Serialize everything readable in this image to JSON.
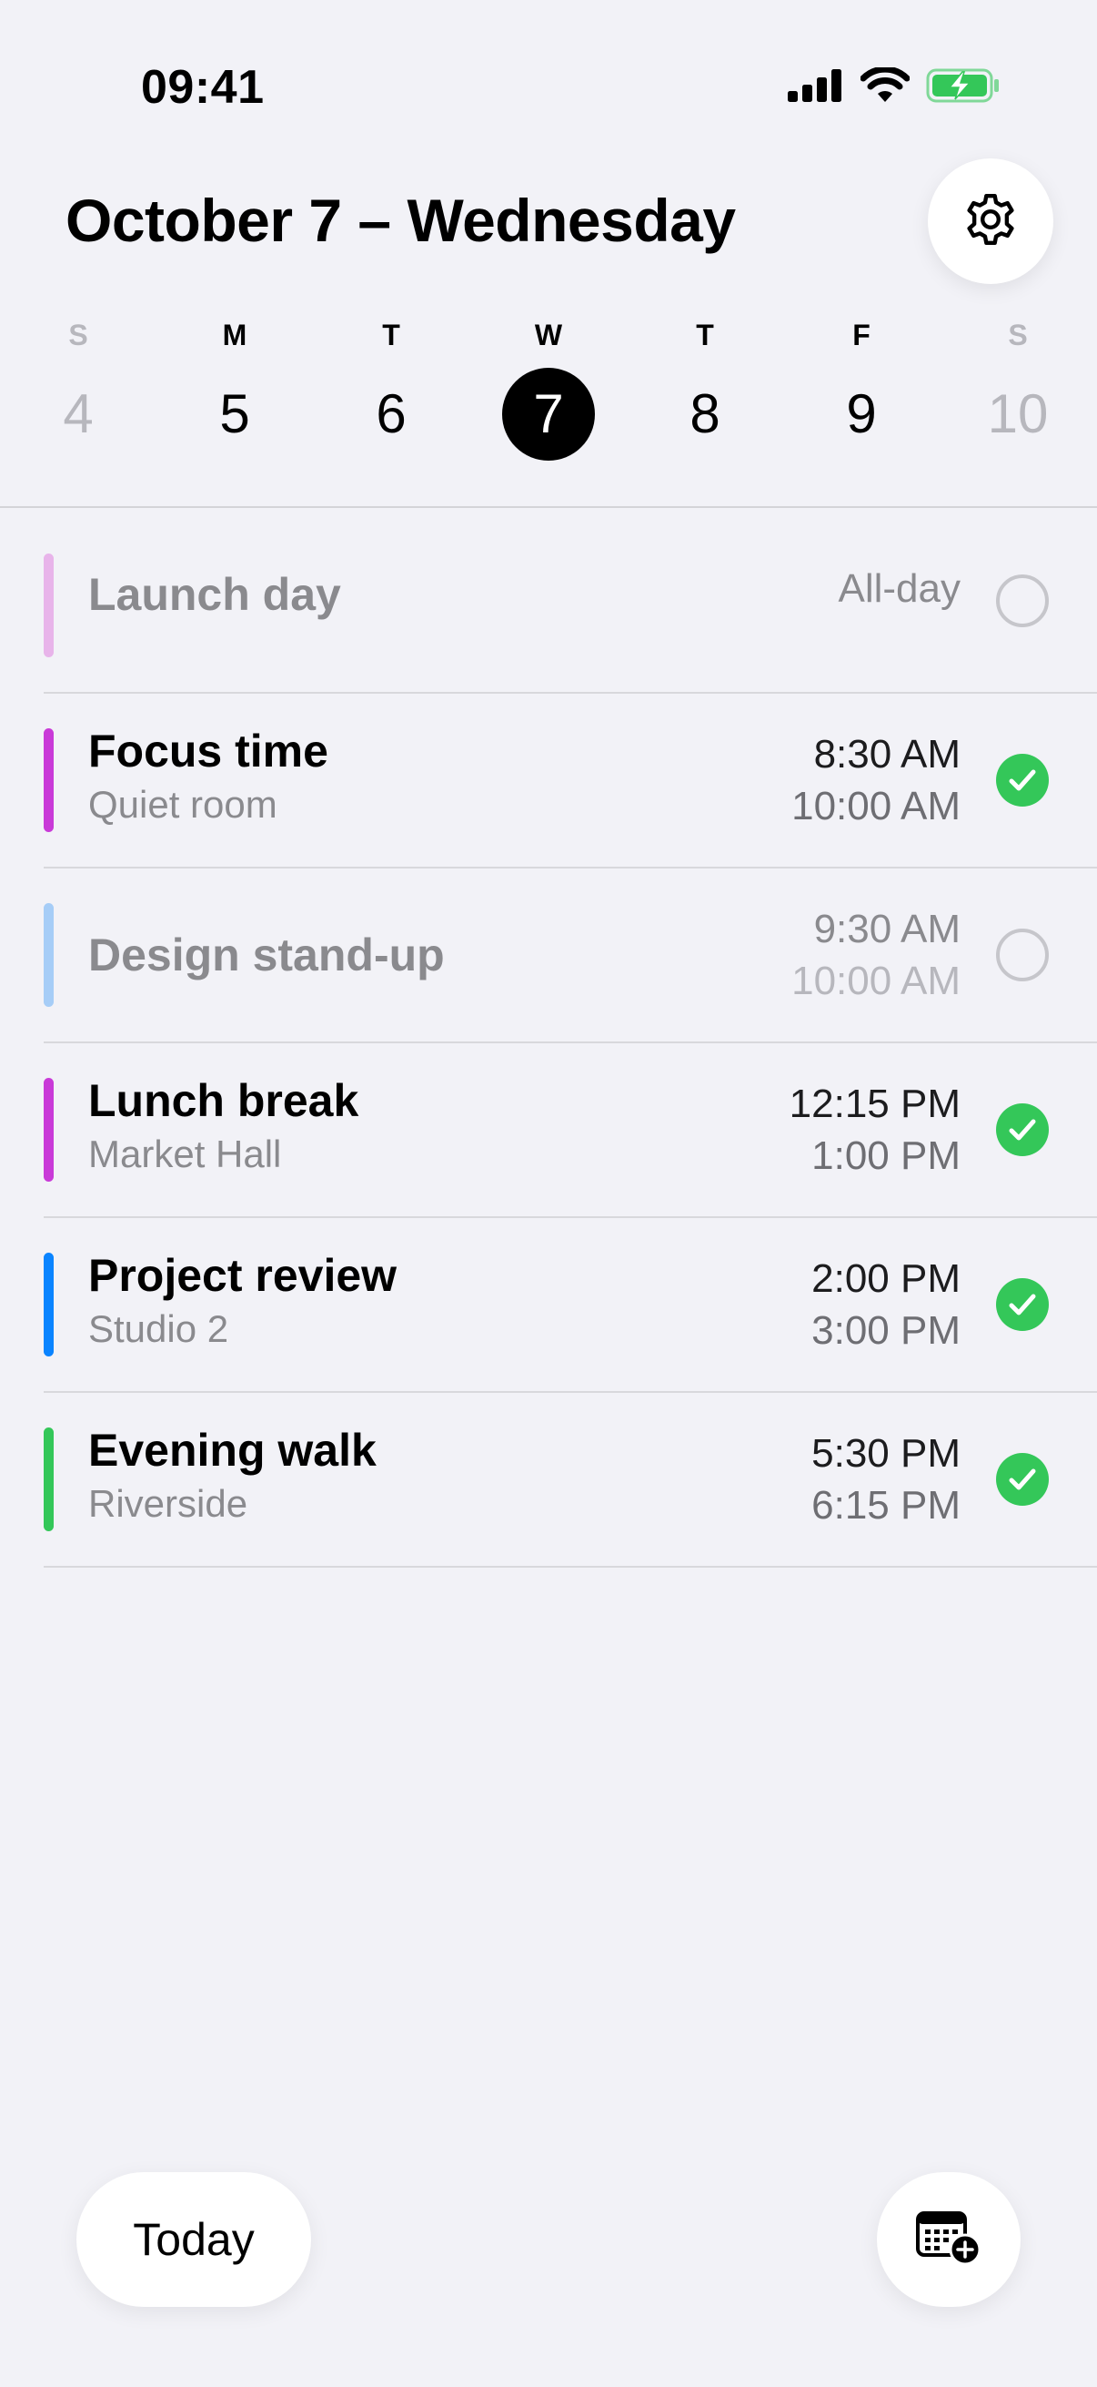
{
  "status_bar": {
    "time": "09:41",
    "icons": [
      "cellular-signal-icon",
      "wifi-icon",
      "battery-charging-icon"
    ],
    "battery_color": "#34c759"
  },
  "header": {
    "title": "October 7 – Wednesday",
    "settings_icon": "gear-icon"
  },
  "week": [
    {
      "letter": "S",
      "number": "4",
      "weekend": true,
      "selected": false
    },
    {
      "letter": "M",
      "number": "5",
      "weekend": false,
      "selected": false
    },
    {
      "letter": "T",
      "number": "6",
      "weekend": false,
      "selected": false
    },
    {
      "letter": "W",
      "number": "7",
      "weekend": false,
      "selected": true
    },
    {
      "letter": "T",
      "number": "8",
      "weekend": false,
      "selected": false
    },
    {
      "letter": "F",
      "number": "9",
      "weekend": false,
      "selected": false
    },
    {
      "letter": "S",
      "number": "10",
      "weekend": true,
      "selected": false
    }
  ],
  "events": [
    {
      "title": "Launch day",
      "subtitle": "",
      "all_day_label": "All-day",
      "start": "",
      "end": "",
      "color": "#e8b4ea",
      "done": false
    },
    {
      "title": "Focus time",
      "subtitle": "Quiet room",
      "all_day_label": "",
      "start": "8:30 AM",
      "end": "10:00 AM",
      "color": "#c93ad8",
      "done": true
    },
    {
      "title": "Design stand-up",
      "subtitle": "",
      "all_day_label": "",
      "start": "9:30 AM",
      "end": "10:00 AM",
      "color": "#a6cdf7",
      "done": false
    },
    {
      "title": "Lunch break",
      "subtitle": "Market Hall",
      "all_day_label": "",
      "start": "12:15 PM",
      "end": "1:00 PM",
      "color": "#c93ad8",
      "done": true
    },
    {
      "title": "Project review",
      "subtitle": "Studio 2",
      "all_day_label": "",
      "start": "2:00 PM",
      "end": "3:00 PM",
      "color": "#0a84ff",
      "done": true
    },
    {
      "title": "Evening walk",
      "subtitle": "Riverside",
      "all_day_label": "",
      "start": "5:30 PM",
      "end": "6:15 PM",
      "color": "#34c759",
      "done": true
    }
  ],
  "footer": {
    "today_label": "Today",
    "add_event_icon": "calendar-add-icon"
  },
  "colors": {
    "background": "#f2f2f7",
    "done_check": "#34c759",
    "selected_day": "#000000"
  }
}
